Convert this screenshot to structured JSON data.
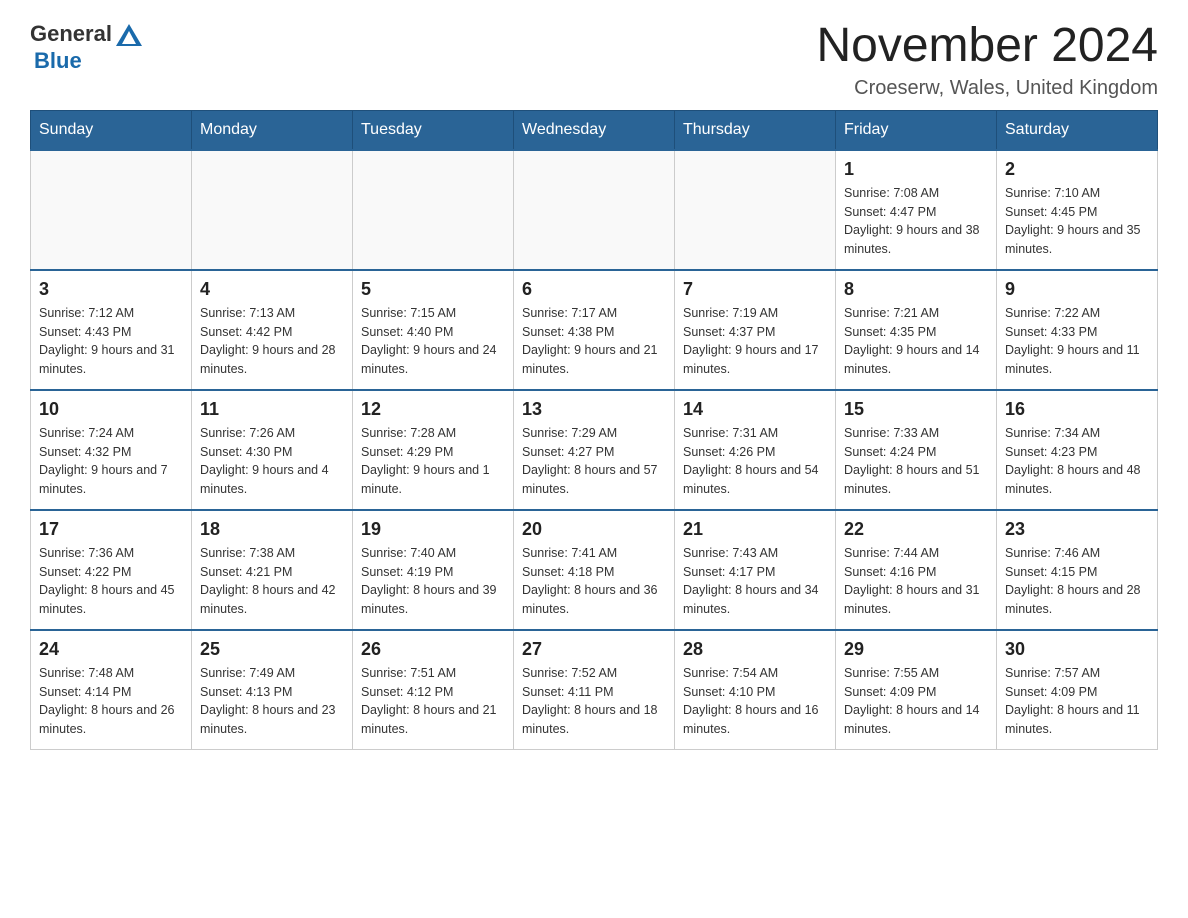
{
  "logo": {
    "text_general": "General",
    "text_blue": "Blue"
  },
  "header": {
    "month_year": "November 2024",
    "location": "Croeserw, Wales, United Kingdom"
  },
  "weekdays": [
    "Sunday",
    "Monday",
    "Tuesday",
    "Wednesday",
    "Thursday",
    "Friday",
    "Saturday"
  ],
  "weeks": [
    [
      {
        "day": "",
        "info": ""
      },
      {
        "day": "",
        "info": ""
      },
      {
        "day": "",
        "info": ""
      },
      {
        "day": "",
        "info": ""
      },
      {
        "day": "",
        "info": ""
      },
      {
        "day": "1",
        "info": "Sunrise: 7:08 AM\nSunset: 4:47 PM\nDaylight: 9 hours and 38 minutes."
      },
      {
        "day": "2",
        "info": "Sunrise: 7:10 AM\nSunset: 4:45 PM\nDaylight: 9 hours and 35 minutes."
      }
    ],
    [
      {
        "day": "3",
        "info": "Sunrise: 7:12 AM\nSunset: 4:43 PM\nDaylight: 9 hours and 31 minutes."
      },
      {
        "day": "4",
        "info": "Sunrise: 7:13 AM\nSunset: 4:42 PM\nDaylight: 9 hours and 28 minutes."
      },
      {
        "day": "5",
        "info": "Sunrise: 7:15 AM\nSunset: 4:40 PM\nDaylight: 9 hours and 24 minutes."
      },
      {
        "day": "6",
        "info": "Sunrise: 7:17 AM\nSunset: 4:38 PM\nDaylight: 9 hours and 21 minutes."
      },
      {
        "day": "7",
        "info": "Sunrise: 7:19 AM\nSunset: 4:37 PM\nDaylight: 9 hours and 17 minutes."
      },
      {
        "day": "8",
        "info": "Sunrise: 7:21 AM\nSunset: 4:35 PM\nDaylight: 9 hours and 14 minutes."
      },
      {
        "day": "9",
        "info": "Sunrise: 7:22 AM\nSunset: 4:33 PM\nDaylight: 9 hours and 11 minutes."
      }
    ],
    [
      {
        "day": "10",
        "info": "Sunrise: 7:24 AM\nSunset: 4:32 PM\nDaylight: 9 hours and 7 minutes."
      },
      {
        "day": "11",
        "info": "Sunrise: 7:26 AM\nSunset: 4:30 PM\nDaylight: 9 hours and 4 minutes."
      },
      {
        "day": "12",
        "info": "Sunrise: 7:28 AM\nSunset: 4:29 PM\nDaylight: 9 hours and 1 minute."
      },
      {
        "day": "13",
        "info": "Sunrise: 7:29 AM\nSunset: 4:27 PM\nDaylight: 8 hours and 57 minutes."
      },
      {
        "day": "14",
        "info": "Sunrise: 7:31 AM\nSunset: 4:26 PM\nDaylight: 8 hours and 54 minutes."
      },
      {
        "day": "15",
        "info": "Sunrise: 7:33 AM\nSunset: 4:24 PM\nDaylight: 8 hours and 51 minutes."
      },
      {
        "day": "16",
        "info": "Sunrise: 7:34 AM\nSunset: 4:23 PM\nDaylight: 8 hours and 48 minutes."
      }
    ],
    [
      {
        "day": "17",
        "info": "Sunrise: 7:36 AM\nSunset: 4:22 PM\nDaylight: 8 hours and 45 minutes."
      },
      {
        "day": "18",
        "info": "Sunrise: 7:38 AM\nSunset: 4:21 PM\nDaylight: 8 hours and 42 minutes."
      },
      {
        "day": "19",
        "info": "Sunrise: 7:40 AM\nSunset: 4:19 PM\nDaylight: 8 hours and 39 minutes."
      },
      {
        "day": "20",
        "info": "Sunrise: 7:41 AM\nSunset: 4:18 PM\nDaylight: 8 hours and 36 minutes."
      },
      {
        "day": "21",
        "info": "Sunrise: 7:43 AM\nSunset: 4:17 PM\nDaylight: 8 hours and 34 minutes."
      },
      {
        "day": "22",
        "info": "Sunrise: 7:44 AM\nSunset: 4:16 PM\nDaylight: 8 hours and 31 minutes."
      },
      {
        "day": "23",
        "info": "Sunrise: 7:46 AM\nSunset: 4:15 PM\nDaylight: 8 hours and 28 minutes."
      }
    ],
    [
      {
        "day": "24",
        "info": "Sunrise: 7:48 AM\nSunset: 4:14 PM\nDaylight: 8 hours and 26 minutes."
      },
      {
        "day": "25",
        "info": "Sunrise: 7:49 AM\nSunset: 4:13 PM\nDaylight: 8 hours and 23 minutes."
      },
      {
        "day": "26",
        "info": "Sunrise: 7:51 AM\nSunset: 4:12 PM\nDaylight: 8 hours and 21 minutes."
      },
      {
        "day": "27",
        "info": "Sunrise: 7:52 AM\nSunset: 4:11 PM\nDaylight: 8 hours and 18 minutes."
      },
      {
        "day": "28",
        "info": "Sunrise: 7:54 AM\nSunset: 4:10 PM\nDaylight: 8 hours and 16 minutes."
      },
      {
        "day": "29",
        "info": "Sunrise: 7:55 AM\nSunset: 4:09 PM\nDaylight: 8 hours and 14 minutes."
      },
      {
        "day": "30",
        "info": "Sunrise: 7:57 AM\nSunset: 4:09 PM\nDaylight: 8 hours and 11 minutes."
      }
    ]
  ]
}
